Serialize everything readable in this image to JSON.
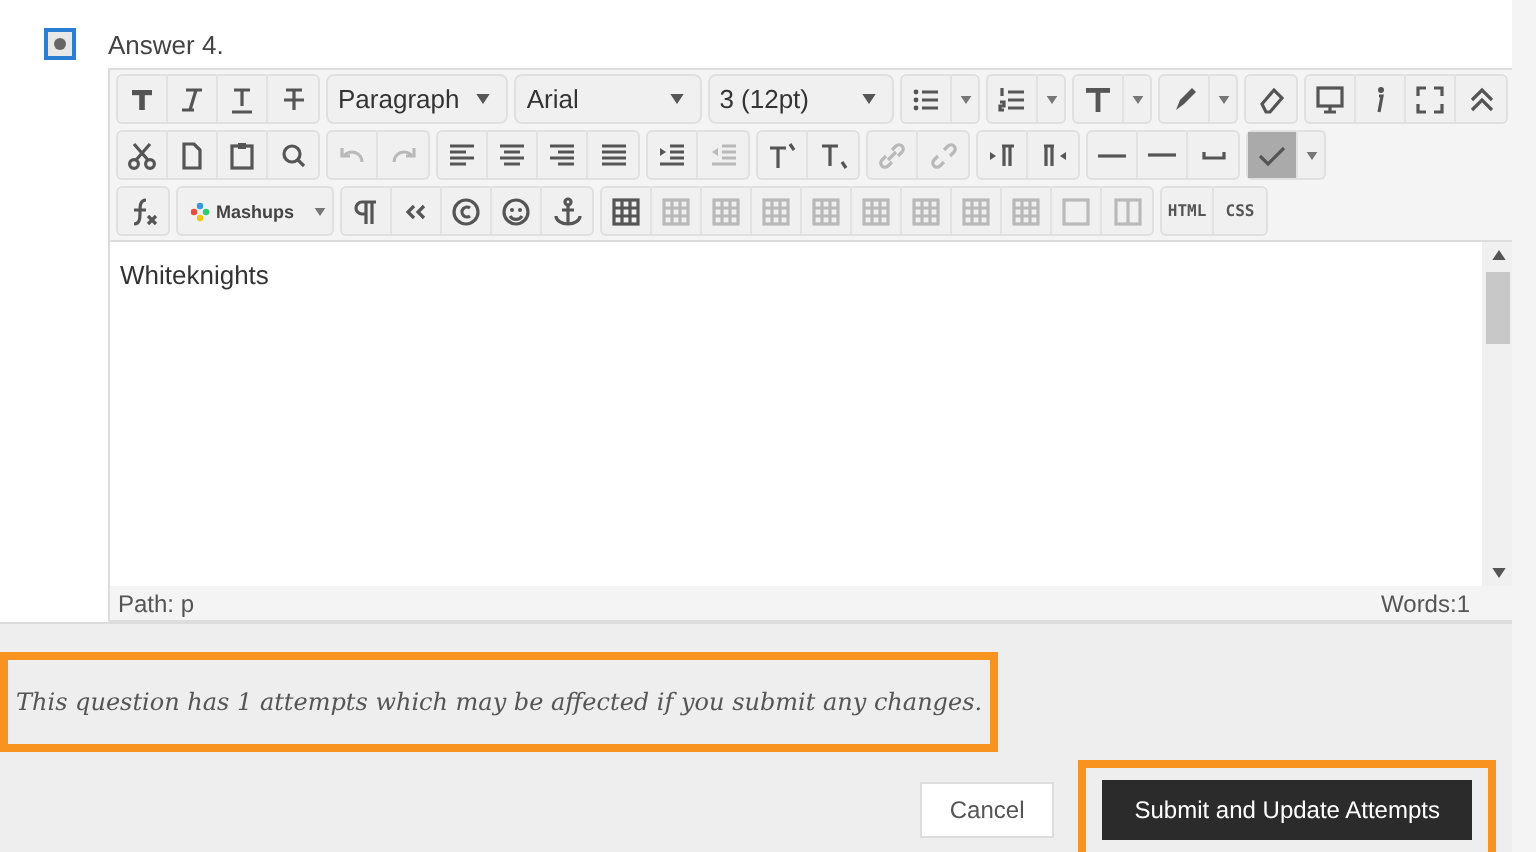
{
  "answer": {
    "label": "Answer 4.",
    "selected": true
  },
  "toolbar": [
    [
      {
        "kind": "buttons",
        "items": [
          {
            "kind": "bold",
            "disabled": false
          },
          {
            "kind": "italic",
            "disabled": false
          },
          {
            "kind": "underline",
            "disabled": false
          },
          {
            "kind": "strike",
            "disabled": false
          }
        ]
      },
      {
        "kind": "select",
        "label": "Paragraph"
      },
      {
        "kind": "select",
        "label": "Arial"
      },
      {
        "kind": "select",
        "label": "3 (12pt)"
      },
      {
        "kind": "split",
        "item": {
          "kind": "bullets",
          "disabled": false,
          "selected": false
        }
      },
      {
        "kind": "split",
        "item": {
          "kind": "numbers",
          "disabled": false,
          "selected": false
        }
      },
      {
        "kind": "split",
        "item": {
          "kind": "textcolor",
          "disabled": false,
          "selected": false
        }
      },
      {
        "kind": "split",
        "item": {
          "kind": "marker",
          "disabled": false,
          "selected": false
        }
      },
      {
        "kind": "buttons",
        "items": [
          {
            "kind": "eraser",
            "disabled": false
          }
        ]
      },
      {
        "kind": "buttons",
        "items": [
          {
            "kind": "preview",
            "disabled": false
          },
          {
            "kind": "info",
            "disabled": false
          },
          {
            "kind": "fullscreen",
            "disabled": false
          },
          {
            "kind": "collapse",
            "disabled": false
          }
        ]
      }
    ],
    [
      {
        "kind": "buttons",
        "items": [
          {
            "kind": "cut",
            "disabled": false
          },
          {
            "kind": "copy",
            "disabled": false
          },
          {
            "kind": "paste",
            "disabled": false
          },
          {
            "kind": "find",
            "disabled": false
          }
        ]
      },
      {
        "kind": "buttons",
        "items": [
          {
            "kind": "undo",
            "disabled": true
          },
          {
            "kind": "redo",
            "disabled": true
          }
        ]
      },
      {
        "kind": "buttons",
        "items": [
          {
            "kind": "alignleft",
            "disabled": false
          },
          {
            "kind": "aligncenter",
            "disabled": false
          },
          {
            "kind": "alignright",
            "disabled": false
          },
          {
            "kind": "justify",
            "disabled": false
          }
        ]
      },
      {
        "kind": "buttons",
        "items": [
          {
            "kind": "indent",
            "disabled": false
          },
          {
            "kind": "outdent",
            "disabled": true
          }
        ]
      },
      {
        "kind": "buttons",
        "items": [
          {
            "kind": "superscript",
            "disabled": false
          },
          {
            "kind": "subscript",
            "disabled": false
          }
        ]
      },
      {
        "kind": "buttons",
        "items": [
          {
            "kind": "link",
            "disabled": true
          },
          {
            "kind": "unlink",
            "disabled": true
          }
        ]
      },
      {
        "kind": "buttons",
        "items": [
          {
            "kind": "ltr",
            "disabled": false
          },
          {
            "kind": "rtl",
            "disabled": false
          }
        ]
      },
      {
        "kind": "buttons",
        "items": [
          {
            "kind": "rule",
            "disabled": false
          },
          {
            "kind": "thickrule",
            "disabled": false
          },
          {
            "kind": "space",
            "disabled": false
          }
        ]
      },
      {
        "kind": "split",
        "item": {
          "kind": "spellcheck",
          "disabled": false,
          "selected": true
        }
      }
    ],
    [
      {
        "kind": "buttons",
        "items": [
          {
            "kind": "formula",
            "disabled": false
          }
        ]
      },
      {
        "kind": "mashups",
        "label": "Mashups"
      },
      {
        "kind": "buttons",
        "items": [
          {
            "kind": "pilcrow",
            "disabled": false
          },
          {
            "kind": "quote",
            "disabled": false
          },
          {
            "kind": "copyright",
            "disabled": false
          },
          {
            "kind": "emoji",
            "disabled": false
          },
          {
            "kind": "anchor",
            "disabled": false
          }
        ]
      },
      {
        "kind": "buttons",
        "items": [
          {
            "kind": "table",
            "disabled": false
          },
          {
            "kind": "table",
            "disabled": true
          },
          {
            "kind": "table",
            "disabled": true
          },
          {
            "kind": "table",
            "disabled": true
          },
          {
            "kind": "table",
            "disabled": true
          },
          {
            "kind": "table",
            "disabled": true
          },
          {
            "kind": "table",
            "disabled": true
          },
          {
            "kind": "table",
            "disabled": true
          },
          {
            "kind": "table",
            "disabled": true
          },
          {
            "kind": "cell",
            "disabled": true
          },
          {
            "kind": "columns",
            "disabled": true
          }
        ]
      },
      {
        "kind": "labels",
        "items": [
          {
            "label": "HTML"
          },
          {
            "label": "CSS"
          }
        ]
      }
    ]
  ],
  "editor": {
    "content": "Whiteknights",
    "path": "Path: p",
    "words": "Words:1"
  },
  "dialog": {
    "message": "This question has 1 attempts which may be affected if you submit any changes.",
    "message_highlighted": true,
    "buttons": [
      {
        "label": "Cancel",
        "kind": "secondary",
        "highlighted": false
      },
      {
        "label": "Submit and Update Attempts",
        "kind": "primary",
        "highlighted": true
      }
    ]
  }
}
